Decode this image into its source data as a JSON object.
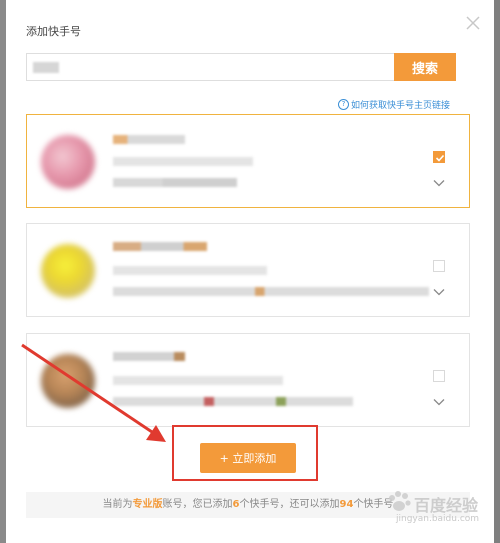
{
  "dialog": {
    "title": "添加快手号",
    "search": {
      "value": "",
      "button_label": "搜索"
    },
    "help_link": "如何获取快手号主页链接",
    "help_icon": "?",
    "cards": [
      {
        "selected": true
      },
      {
        "selected": false
      },
      {
        "selected": false
      }
    ],
    "add_button_label": "+ 立即添加",
    "footer": {
      "p1": "当前为",
      "edition": "专业版",
      "p2": "账号，您已添加",
      "added": "6",
      "p3": "个快手号，还可以添加",
      "remaining": "94",
      "p4": "个快手号"
    }
  },
  "watermark": {
    "text": "百度经验",
    "url": "jingyan.baidu.com"
  },
  "colors": {
    "accent": "#f39a3a",
    "link": "#3b8fd6",
    "annotation": "#e03a2f",
    "selected_border": "#f0b33f"
  },
  "icons": {
    "close": "close-icon",
    "check": "check-icon",
    "chevron": "chevron-down-icon",
    "help": "help-circle-icon",
    "arrow": "annotation-arrow"
  }
}
